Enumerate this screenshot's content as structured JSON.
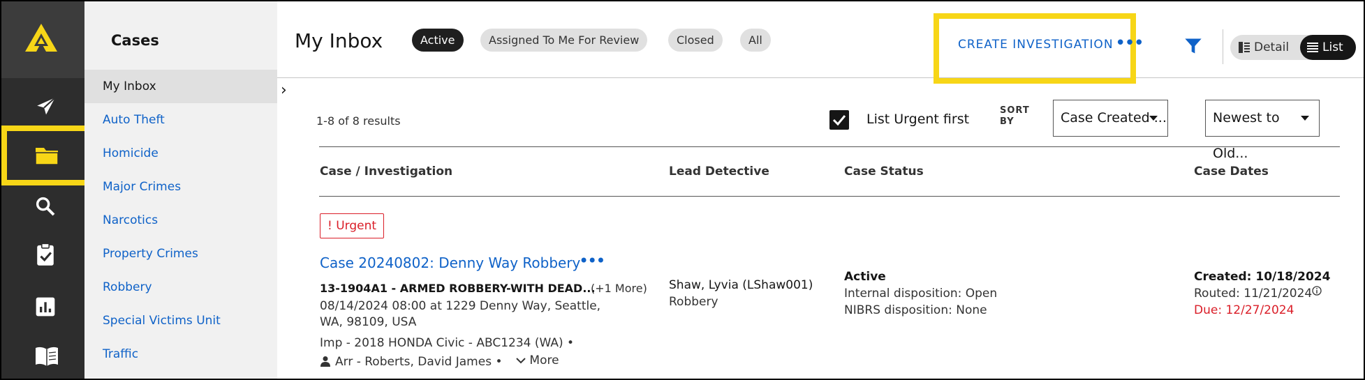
{
  "colors": {
    "accent_blue": "#0f62c8",
    "highlight_yellow": "#f7d617",
    "rail_bg": "#2d2d2d",
    "urgent_red": "#da1e28"
  },
  "rail": {
    "icons": [
      "logo-icon",
      "send-icon",
      "folder-icon",
      "search-icon",
      "clipboard-check-icon",
      "bar-chart-icon",
      "book-icon"
    ],
    "selected": "folder-icon"
  },
  "sidebar": {
    "title": "Cases",
    "items": [
      {
        "label": "My Inbox",
        "selected": true
      },
      {
        "label": "Auto Theft"
      },
      {
        "label": "Homicide"
      },
      {
        "label": "Major Crimes"
      },
      {
        "label": "Narcotics"
      },
      {
        "label": "Property Crimes"
      },
      {
        "label": "Robbery"
      },
      {
        "label": "Special Victims Unit"
      },
      {
        "label": "Traffic"
      }
    ]
  },
  "header": {
    "title": "My Inbox",
    "filters": [
      {
        "label": "Active",
        "selected": true
      },
      {
        "label": "Assigned To Me For Review"
      },
      {
        "label": "Closed"
      },
      {
        "label": "All"
      }
    ],
    "create_label": "CREATE INVESTIGATION",
    "more_label": "•••",
    "view": {
      "detail_label": "Detail",
      "list_label": "List",
      "selected": "List"
    }
  },
  "toolbar": {
    "results": "1-8 of 8 results",
    "urgent_first_label": "List Urgent first",
    "urgent_first_checked": true,
    "sort_by_label_1": "SORT",
    "sort_by_label_2": "BY",
    "sort_field": "Case Created ...",
    "sort_order": "Newest to Old..."
  },
  "table": {
    "columns": [
      "Case / Investigation",
      "Lead Detective",
      "Case Status",
      "Case Dates"
    ],
    "rows": [
      {
        "urgent_badge": "! Urgent",
        "case_title": "Case 20240802: Denny Way Robbery",
        "case_more": "•••",
        "offense": "13-1904A1 - ARMED ROBBERY-WITH DEAD...",
        "offense_more": "(+1 More)",
        "incident": "08/14/2024 08:00 at 1229 Denny Way, Seattle, WA, 98109, USA",
        "vehicle": "Imp - 2018 HONDA Civic - ABC1234 (WA)  •",
        "arrest": "Arr - Roberts, David James  •",
        "more_label": "More",
        "lead_detective": "Shaw, Lyvia (LShaw001)",
        "lead_unit": "Robbery",
        "status": "Active",
        "internal_disposition": "Internal disposition: Open",
        "nibrs_disposition": "NIBRS disposition: None",
        "created": "Created: 10/18/2024",
        "routed": "Routed: 11/21/2024",
        "due": "Due: 12/27/2024"
      }
    ]
  }
}
